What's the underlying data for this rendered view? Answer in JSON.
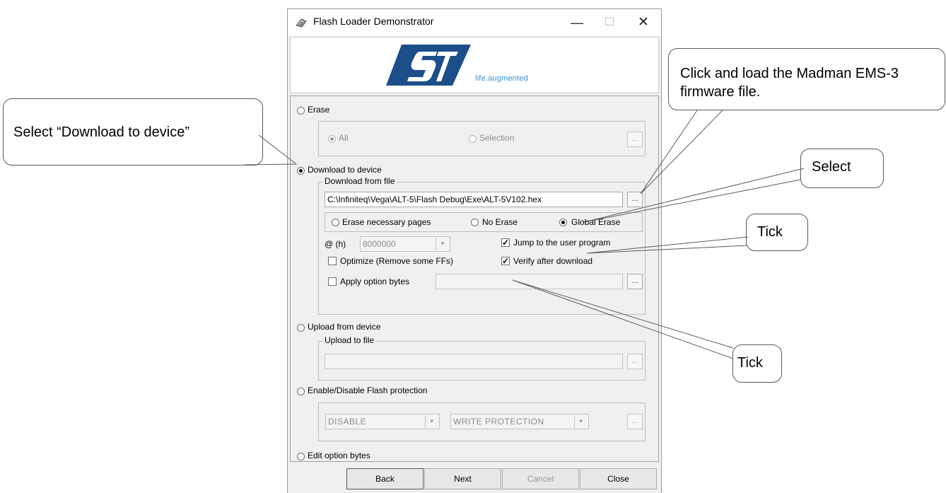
{
  "window": {
    "title": "Flash Loader Demonstrator",
    "minimize_symbol": "—",
    "maximize_symbol": "☐",
    "close_symbol": "✕",
    "icon": "flash-loader-icon"
  },
  "banner": {
    "brand": "ST",
    "tagline": "life.augmented"
  },
  "erase": {
    "label": "Erase",
    "all_label": "All",
    "selection_label": "Selection",
    "browse_label": "..."
  },
  "download": {
    "label": "Download to device",
    "group_label": "Download from file",
    "file_path": "C:\\Infiniteq\\Vega\\ALT-5\\Flash Debug\\Exe\\ALT-5V102.hex",
    "browse_label": "...",
    "erase_options": [
      "Erase necessary pages",
      "No Erase",
      "Global Erase"
    ],
    "selected_erase_option": "Global Erase",
    "address_label": "@ (h)",
    "address_value": "8000000",
    "jump_label": "Jump to the user program",
    "jump_checked": true,
    "optimize_label": "Optimize (Remove some FFs)",
    "optimize_checked": false,
    "verify_label": "Verify after download",
    "verify_checked": true,
    "apply_option_bytes_label": "Apply option bytes",
    "apply_option_bytes_checked": false,
    "option_bytes_browse_label": "..."
  },
  "upload": {
    "label": "Upload from device",
    "group_label": "Upload to file",
    "file_path": "",
    "browse_label": "..."
  },
  "protection": {
    "label": "Enable/Disable Flash protection",
    "mode_value": "DISABLE",
    "type_value": "WRITE PROTECTION",
    "browse_label": "..."
  },
  "edit_option_bytes": {
    "label": "Edit option bytes"
  },
  "footer": {
    "back": "Back",
    "next": "Next",
    "cancel": "Cancel",
    "close": "Close"
  },
  "callouts": {
    "select_download": "Select “Download to device”",
    "load_firmware": "Click and load the Madman EMS-3 firmware file.",
    "select_global": "Select",
    "tick_jump": "Tick",
    "tick_verify": "Tick"
  },
  "colors": {
    "tagline": "#3a8fd4",
    "logo": "#1c4f8a",
    "window_bg": "#f0f0f0"
  }
}
